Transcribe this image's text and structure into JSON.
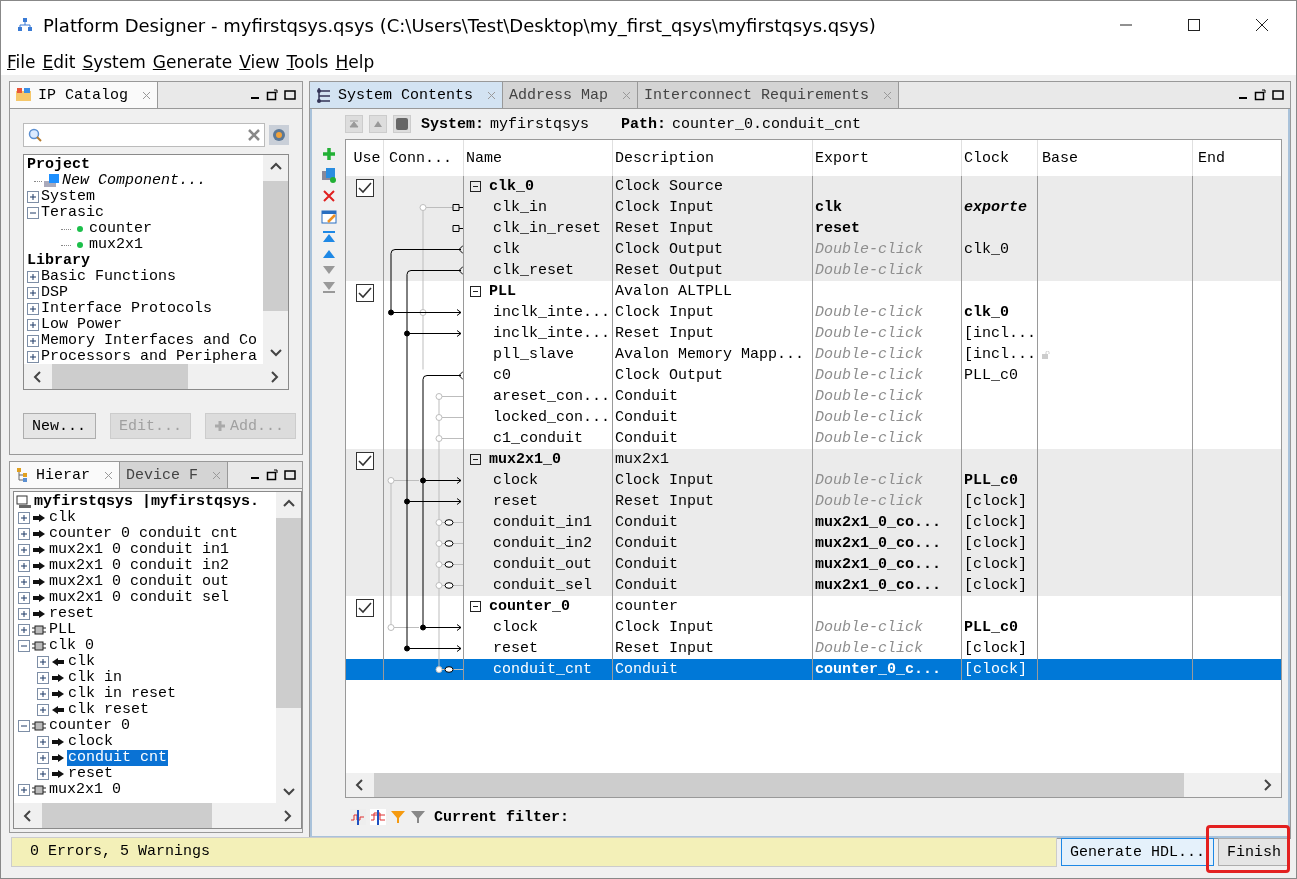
{
  "window": {
    "title": "Platform Designer - myfirstqsys.qsys (C:\\Users\\Test\\Desktop\\my_first_qsys\\myfirstqsys.qsys)"
  },
  "menu": [
    "File",
    "Edit",
    "System",
    "Generate",
    "View",
    "Tools",
    "Help"
  ],
  "ip_catalog": {
    "tabs": [
      {
        "label": "IP Catalog",
        "selected": true
      }
    ],
    "tree": [
      {
        "label": "Project",
        "kind": "header"
      },
      {
        "label": "New Component...",
        "kind": "action"
      },
      {
        "label": "System",
        "kind": "group",
        "expanded": false
      },
      {
        "label": "Terasic",
        "kind": "group",
        "expanded": true,
        "children": [
          {
            "label": "counter",
            "kind": "component"
          },
          {
            "label": "mux2x1",
            "kind": "component"
          }
        ]
      },
      {
        "label": "Library",
        "kind": "header"
      },
      {
        "label": "Basic Functions",
        "kind": "group",
        "expanded": false
      },
      {
        "label": "DSP",
        "kind": "group",
        "expanded": false
      },
      {
        "label": "Interface Protocols",
        "kind": "group",
        "expanded": false
      },
      {
        "label": "Low Power",
        "kind": "group",
        "expanded": false
      },
      {
        "label": "Memory Interfaces and Co",
        "kind": "group",
        "expanded": false
      },
      {
        "label": "Processors and Periphera",
        "kind": "group",
        "expanded": false
      }
    ],
    "buttons": [
      {
        "label": "New...",
        "kind": "plain",
        "disabled": false
      },
      {
        "label": "Edit...",
        "kind": "plain",
        "disabled": true
      },
      {
        "label": "Add...",
        "kind": "add",
        "disabled": true
      }
    ]
  },
  "hierarchy": {
    "tabs": [
      {
        "label": "Hierar",
        "selected": true
      },
      {
        "label": "Device F",
        "selected": false
      }
    ],
    "root": "myfirstqsys |myfirstqsys.",
    "items": [
      {
        "label": "clk",
        "kind": "export",
        "expanded": false,
        "selected": false
      },
      {
        "label": "counter 0 conduit cnt",
        "kind": "export",
        "expanded": false,
        "selected": false
      },
      {
        "label": "mux2x1 0 conduit in1",
        "kind": "export",
        "expanded": false,
        "selected": false
      },
      {
        "label": "mux2x1 0 conduit in2",
        "kind": "export",
        "expanded": false,
        "selected": false
      },
      {
        "label": "mux2x1 0 conduit out",
        "kind": "export",
        "expanded": false,
        "selected": false
      },
      {
        "label": "mux2x1 0 conduit sel",
        "kind": "export",
        "expanded": false,
        "selected": false
      },
      {
        "label": "reset",
        "kind": "export",
        "expanded": false,
        "selected": false
      },
      {
        "label": "PLL",
        "kind": "module",
        "expanded": false,
        "selected": false
      },
      {
        "label": "clk 0",
        "kind": "module",
        "expanded": true,
        "selected": false,
        "children": [
          {
            "label": "clk",
            "kind": "output",
            "expanded": false,
            "selected": false
          },
          {
            "label": "clk in",
            "kind": "export",
            "expanded": false,
            "selected": false
          },
          {
            "label": "clk in reset",
            "kind": "export",
            "expanded": false,
            "selected": false
          },
          {
            "label": "clk reset",
            "kind": "output",
            "expanded": false,
            "selected": false
          }
        ]
      },
      {
        "label": "counter 0",
        "kind": "module",
        "expanded": true,
        "selected": false,
        "children": [
          {
            "label": "clock",
            "kind": "export",
            "expanded": false,
            "selected": false
          },
          {
            "label": "conduit cnt",
            "kind": "export",
            "expanded": false,
            "selected": true
          },
          {
            "label": "reset",
            "kind": "export",
            "expanded": false,
            "selected": false
          }
        ]
      },
      {
        "label": "mux2x1 0",
        "kind": "module",
        "expanded": false,
        "selected": false
      }
    ]
  },
  "system_contents": {
    "tabs": [
      {
        "label": "System Contents",
        "selected": true
      },
      {
        "label": "Address Map",
        "selected": false
      },
      {
        "label": "Interconnect Requirements",
        "selected": false
      }
    ],
    "system_label": "System:",
    "system": "myfirstqsys",
    "path_label": "Path:",
    "path": "counter_0.conduit_cnt",
    "columns": [
      "Use",
      "Conn...",
      "Name",
      "Description",
      "Export",
      "Clock",
      "Base",
      "End"
    ],
    "modules": [
      {
        "name": "clk_0",
        "description": "Clock Source",
        "use": true,
        "expanded": true,
        "selected": false,
        "ports": [
          {
            "name": "clk_in",
            "description": "Clock Input",
            "export": "clk",
            "export_hint": false,
            "clock": "exporte",
            "clock_bold": true,
            "clock_italic": true,
            "locked": false,
            "selected": false
          },
          {
            "name": "clk_in_reset",
            "description": "Reset Input",
            "export": "reset",
            "export_hint": false,
            "locked": false,
            "selected": false
          },
          {
            "name": "clk",
            "description": "Clock Output",
            "export": "Double-click",
            "export_hint": true,
            "clock": "clk_0",
            "clock_bold": false,
            "clock_italic": false,
            "locked": false,
            "selected": false
          },
          {
            "name": "clk_reset",
            "description": "Reset Output",
            "export": "Double-click",
            "export_hint": true,
            "locked": false,
            "selected": false
          }
        ]
      },
      {
        "name": "PLL",
        "description": "Avalon ALTPLL",
        "use": true,
        "expanded": true,
        "selected": false,
        "ports": [
          {
            "name": "inclk_inte...",
            "description": "Clock Input",
            "export": "Double-click",
            "export_hint": true,
            "clock": "clk_0",
            "clock_bold": true,
            "clock_italic": false,
            "locked": false,
            "selected": false
          },
          {
            "name": "inclk_inte...",
            "description": "Reset Input",
            "export": "Double-click",
            "export_hint": true,
            "clock": "[incl...",
            "clock_bold": false,
            "clock_italic": false,
            "locked": false,
            "selected": false
          },
          {
            "name": "pll_slave",
            "description": "Avalon Memory Mapp...",
            "export": "Double-click",
            "export_hint": true,
            "clock": "[incl...",
            "clock_bold": false,
            "clock_italic": false,
            "locked": true,
            "selected": false
          },
          {
            "name": "c0",
            "description": "Clock Output",
            "export": "Double-click",
            "export_hint": true,
            "clock": "PLL_c0",
            "clock_bold": false,
            "clock_italic": false,
            "locked": false,
            "selected": false
          },
          {
            "name": "areset_con...",
            "description": "Conduit",
            "export": "Double-click",
            "export_hint": true,
            "locked": false,
            "selected": false
          },
          {
            "name": "locked_con...",
            "description": "Conduit",
            "export": "Double-click",
            "export_hint": true,
            "locked": false,
            "selected": false
          },
          {
            "name": "c1_conduit",
            "description": "Conduit",
            "export": "Double-click",
            "export_hint": true,
            "locked": false,
            "selected": false
          }
        ]
      },
      {
        "name": "mux2x1_0",
        "description": "mux2x1",
        "use": true,
        "expanded": true,
        "selected": false,
        "ports": [
          {
            "name": "clock",
            "description": "Clock Input",
            "export": "Double-click",
            "export_hint": true,
            "clock": "PLL_c0",
            "clock_bold": true,
            "clock_italic": false,
            "locked": false,
            "selected": false
          },
          {
            "name": "reset",
            "description": "Reset Input",
            "export": "Double-click",
            "export_hint": true,
            "clock": "[clock]",
            "clock_bold": false,
            "clock_italic": false,
            "locked": false,
            "selected": false
          },
          {
            "name": "conduit_in1",
            "description": "Conduit",
            "export": "mux2x1_0_co...",
            "export_hint": false,
            "clock": "[clock]",
            "clock_bold": false,
            "clock_italic": false,
            "locked": false,
            "selected": false
          },
          {
            "name": "conduit_in2",
            "description": "Conduit",
            "export": "mux2x1_0_co...",
            "export_hint": false,
            "clock": "[clock]",
            "clock_bold": false,
            "clock_italic": false,
            "locked": false,
            "selected": false
          },
          {
            "name": "conduit_out",
            "description": "Conduit",
            "export": "mux2x1_0_co...",
            "export_hint": false,
            "clock": "[clock]",
            "clock_bold": false,
            "clock_italic": false,
            "locked": false,
            "selected": false
          },
          {
            "name": "conduit_sel",
            "description": "Conduit",
            "export": "mux2x1_0_co...",
            "export_hint": false,
            "clock": "[clock]",
            "clock_bold": false,
            "clock_italic": false,
            "locked": false,
            "selected": false
          }
        ]
      },
      {
        "name": "counter_0",
        "description": "counter",
        "use": true,
        "expanded": true,
        "selected": false,
        "ports": [
          {
            "name": "clock",
            "description": "Clock Input",
            "export": "Double-click",
            "export_hint": true,
            "clock": "PLL_c0",
            "clock_bold": true,
            "clock_italic": false,
            "locked": false,
            "selected": false
          },
          {
            "name": "reset",
            "description": "Reset Input",
            "export": "Double-click",
            "export_hint": true,
            "clock": "[clock]",
            "clock_bold": false,
            "clock_italic": false,
            "locked": false,
            "selected": false
          },
          {
            "name": "conduit_cnt",
            "description": "Conduit",
            "export": "counter_0_c...",
            "export_hint": false,
            "clock": "[clock]",
            "clock_bold": false,
            "clock_italic": false,
            "locked": false,
            "selected": true
          }
        ]
      }
    ],
    "filter_label": "Current filter:"
  },
  "status_bar": {
    "message": "0 Errors, 5 Warnings",
    "buttons": [
      "Generate HDL...",
      "Finish"
    ]
  }
}
